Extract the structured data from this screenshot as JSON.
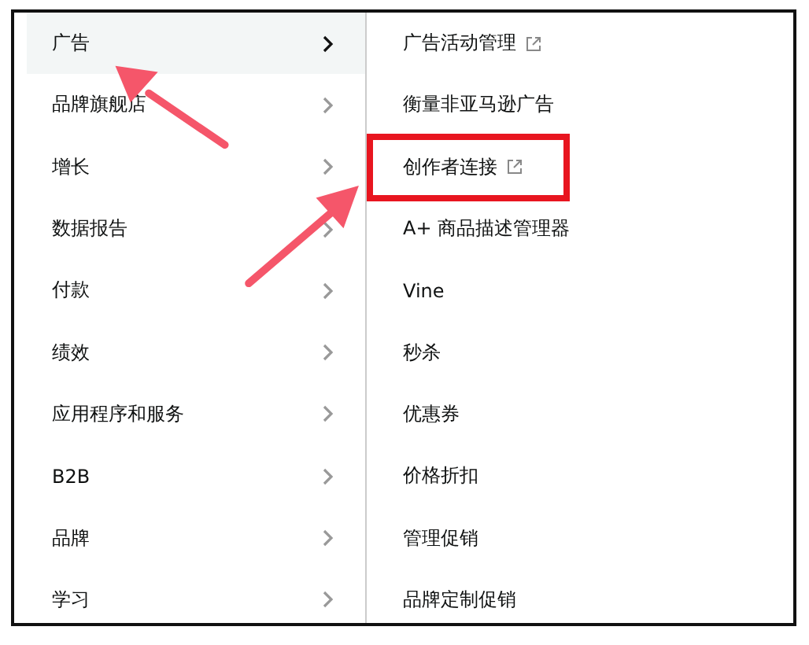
{
  "menu": [
    {
      "label": "广告",
      "selected": true
    },
    {
      "label": "品牌旗舰店",
      "selected": false
    },
    {
      "label": "增长",
      "selected": false
    },
    {
      "label": "数据报告",
      "selected": false
    },
    {
      "label": "付款",
      "selected": false
    },
    {
      "label": "绩效",
      "selected": false
    },
    {
      "label": "应用程序和服务",
      "selected": false
    },
    {
      "label": "B2B",
      "selected": false
    },
    {
      "label": "品牌",
      "selected": false
    },
    {
      "label": "学习",
      "selected": false
    }
  ],
  "submenu": [
    {
      "label": "广告活动管理",
      "external": true,
      "highlighted": false
    },
    {
      "label": "衡量非亚马逊广告",
      "external": false,
      "highlighted": false
    },
    {
      "label": "创作者连接",
      "external": true,
      "highlighted": true
    },
    {
      "label": "A+ 商品描述管理器",
      "external": false,
      "highlighted": false
    },
    {
      "label": "Vine",
      "external": false,
      "highlighted": false
    },
    {
      "label": "秒杀",
      "external": false,
      "highlighted": false
    },
    {
      "label": "优惠券",
      "external": false,
      "highlighted": false
    },
    {
      "label": "价格折扣",
      "external": false,
      "highlighted": false
    },
    {
      "label": "管理促销",
      "external": false,
      "highlighted": false
    },
    {
      "label": "品牌定制促销",
      "external": false,
      "highlighted": false
    }
  ]
}
